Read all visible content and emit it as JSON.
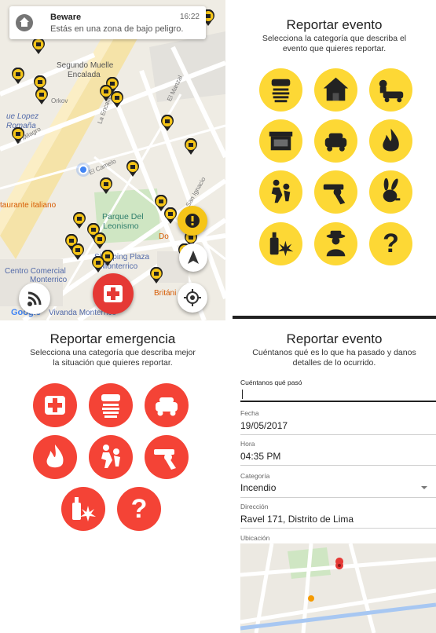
{
  "notification": {
    "title": "Beware",
    "message": "Estás en una zona de bajo peligro.",
    "time": "16:22"
  },
  "map": {
    "labels": [
      "Segundo Muelle",
      "Encalada",
      "ue Lopez",
      "Romaña",
      "El Milagro",
      "Orkov",
      "Parque Del",
      "Leonismo",
      "taurante italiano",
      "Centro Comercial",
      "Monterrico",
      "Vivanda Monterrico",
      "Shopping Plaza",
      "Monterrico",
      "Británi",
      "Do",
      "El Manzal",
      "La Encalada",
      "San Ignacio",
      "El Camelo"
    ],
    "google_label": "Google",
    "colors": {
      "pin": "#f5c518",
      "emergency": "#e53935"
    }
  },
  "report_event": {
    "title": "Reportar evento",
    "subtitle_1": "Selecciona la categoría que describa el",
    "subtitle_2": "evento que quieres reportar.",
    "categories": [
      {
        "icon": "thief-icon"
      },
      {
        "icon": "house-robbery-icon"
      },
      {
        "icon": "car-theft-icon"
      },
      {
        "icon": "store-robbery-icon"
      },
      {
        "icon": "stolen-car-icon"
      },
      {
        "icon": "fire-icon"
      },
      {
        "icon": "assault-icon"
      },
      {
        "icon": "gun-icon"
      },
      {
        "icon": "playboy-bunny-icon"
      },
      {
        "icon": "drugs-alcohol-icon"
      },
      {
        "icon": "suspicious-person-icon"
      },
      {
        "icon": "question-icon",
        "text": "?"
      }
    ],
    "color": "#fdd835"
  },
  "report_emergency": {
    "title": "Reportar emergencia",
    "subtitle_1": "Selecciona una categoría que describa mejor",
    "subtitle_2": "la situación que quieres reportar.",
    "categories": [
      {
        "icon": "medical-icon"
      },
      {
        "icon": "thief-icon"
      },
      {
        "icon": "stolen-car-icon"
      },
      {
        "icon": "fire-icon"
      },
      {
        "icon": "assault-icon"
      },
      {
        "icon": "gun-icon"
      },
      {
        "icon": "drugs-alcohol-icon"
      },
      {
        "icon": "question-icon",
        "text": "?"
      }
    ],
    "color": "#f44336"
  },
  "report_form": {
    "title": "Reportar evento",
    "subtitle_1": "Cuéntanos qué es lo que ha pasado y danos",
    "subtitle_2": "detalles de lo ocurrido.",
    "what_label": "Cuéntanos qué pasó",
    "what_value": "",
    "date_label": "Fecha",
    "date_value": "19/05/2017",
    "time_label": "Hora",
    "time_value": "04:35 PM",
    "category_label": "Categoría",
    "category_value": "Incendio",
    "address_label": "Dirección",
    "address_value": "Ravel 171, Distrito de Lima",
    "location_label": "Ubicación"
  }
}
